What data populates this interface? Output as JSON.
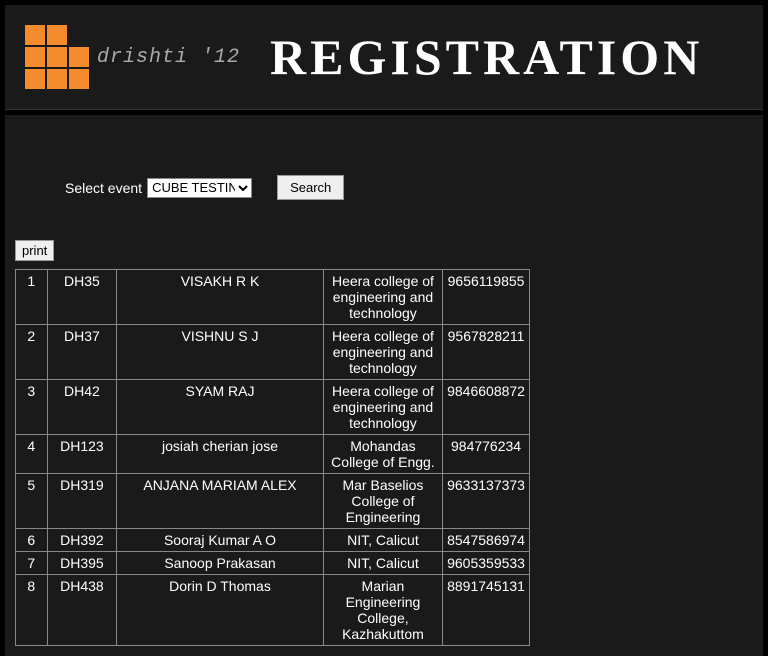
{
  "header": {
    "logo_text": "drishti '12",
    "page_title": "REGISTRATION"
  },
  "search": {
    "label": "Select event",
    "selected_option": "CUBE TESTIN",
    "button_label": "Search"
  },
  "print": {
    "label": "print"
  },
  "table": {
    "rows": [
      {
        "idx": "1",
        "code": "DH35",
        "name": "VISAKH R K",
        "college": "Heera college of engineering and technology",
        "phone": "9656119855"
      },
      {
        "idx": "2",
        "code": "DH37",
        "name": "VISHNU S J",
        "college": "Heera college of engineering and technology",
        "phone": "9567828211"
      },
      {
        "idx": "3",
        "code": "DH42",
        "name": "SYAM RAJ",
        "college": "Heera college of engineering and technology",
        "phone": "9846608872"
      },
      {
        "idx": "4",
        "code": "DH123",
        "name": "josiah cherian jose",
        "college": "Mohandas College of Engg.",
        "phone": "984776234"
      },
      {
        "idx": "5",
        "code": "DH319",
        "name": "ANJANA MARIAM ALEX",
        "college": "Mar Baselios College of Engineering",
        "phone": "9633137373"
      },
      {
        "idx": "6",
        "code": "DH392",
        "name": "Sooraj Kumar A O",
        "college": "NIT, Calicut",
        "phone": "8547586974"
      },
      {
        "idx": "7",
        "code": "DH395",
        "name": "Sanoop Prakasan",
        "college": "NIT, Calicut",
        "phone": "9605359533"
      },
      {
        "idx": "8",
        "code": "DH438",
        "name": "Dorin D Thomas",
        "college": "Marian Engineering College, Kazhakuttom",
        "phone": "8891745131"
      }
    ]
  }
}
